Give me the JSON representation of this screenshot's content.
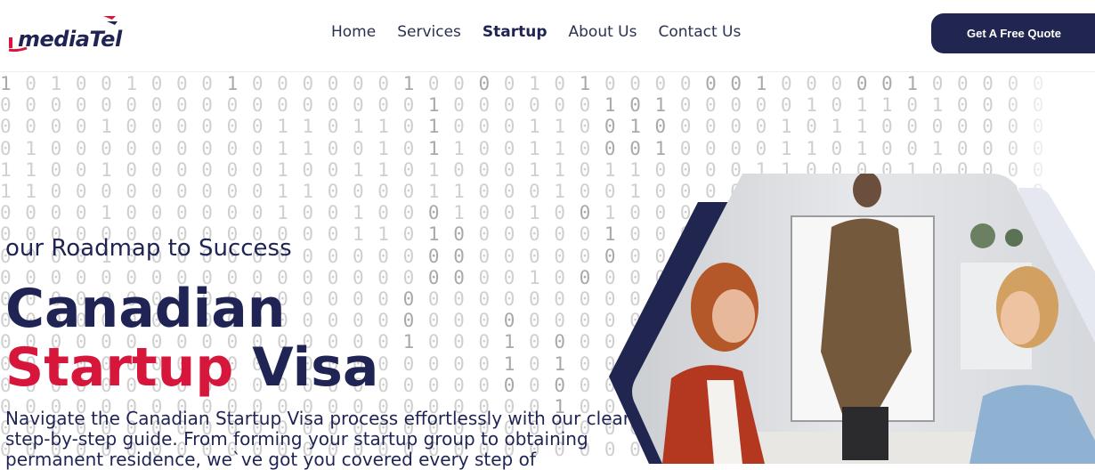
{
  "header": {
    "logo": {
      "part1": "media",
      "part2": "Tel"
    },
    "nav": [
      {
        "label": "Home"
      },
      {
        "label": "Services"
      },
      {
        "label": "Startup"
      },
      {
        "label": "About Us"
      },
      {
        "label": "Contact Us"
      }
    ],
    "cta_label": "Get A Free Quote"
  },
  "hero": {
    "subtitle": "our Roadmap to Success",
    "title_line1": "Canadian",
    "title_red": "Startup",
    "title_rest": " Visa",
    "description": "Navigate the Canadian Startup Visa process effortlessly with our clear, step-by-step guide. From forming your startup group to obtaining permanent residence, we`ve got you covered every step of"
  },
  "colors": {
    "navy": "#20264f",
    "red": "#d6163a"
  }
}
